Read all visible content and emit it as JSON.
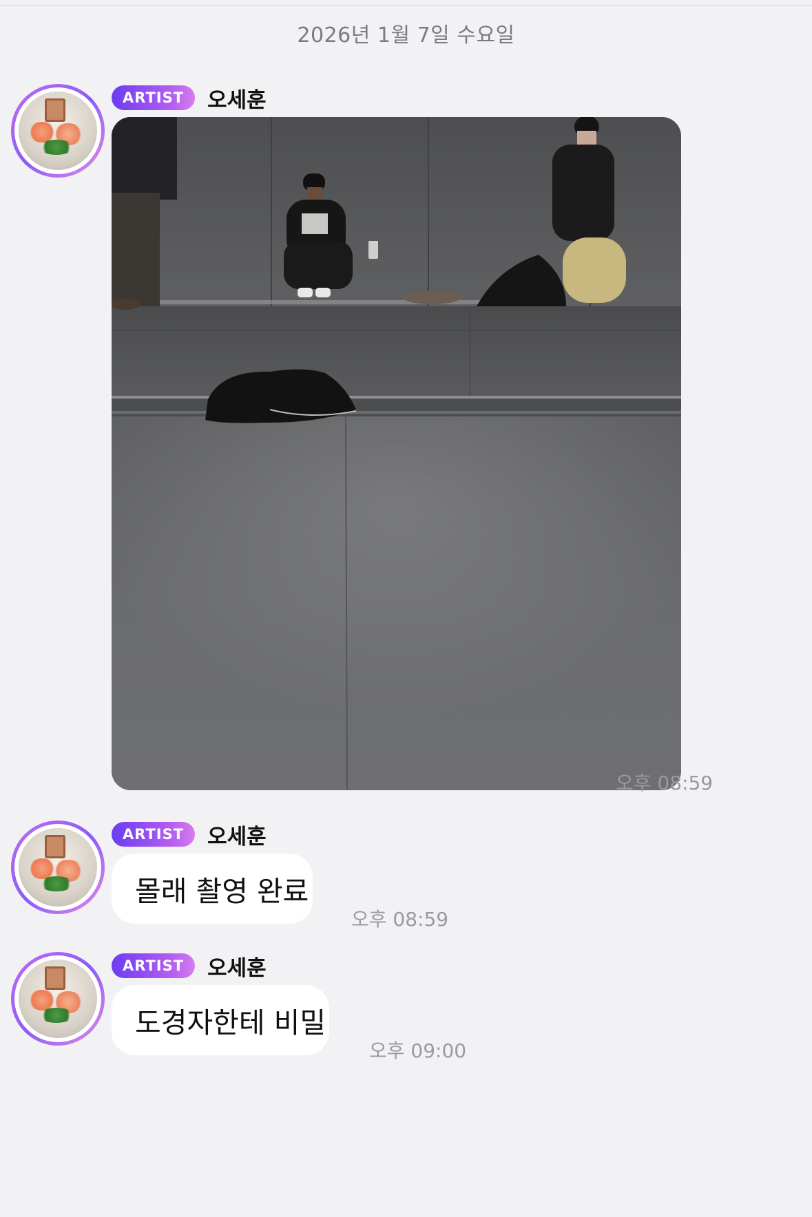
{
  "date_separator": "2026년 1월 7일 수요일",
  "colors": {
    "background": "#f2f2f4",
    "badge_start": "#6a3df2",
    "badge_end": "#d57df0",
    "bubble": "#ffffff",
    "time_text": "#9a9aa0"
  },
  "messages": [
    {
      "badge": "ARTIST",
      "sender": "오세훈",
      "type": "image",
      "time": "오후 08:59"
    },
    {
      "badge": "ARTIST",
      "sender": "오세훈",
      "type": "text",
      "text": "몰래 촬영 완료",
      "time": "오후 08:59"
    },
    {
      "badge": "ARTIST",
      "sender": "오세훈",
      "type": "text",
      "text": "도경자한테 비밀",
      "time": "오후 09:00"
    }
  ]
}
